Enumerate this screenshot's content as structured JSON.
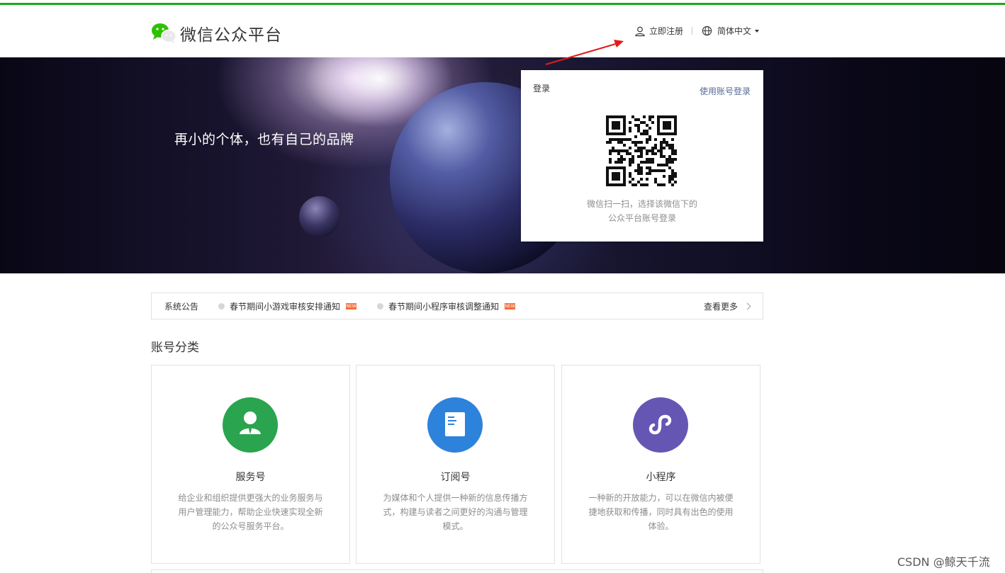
{
  "header": {
    "logo_text": "微信公众平台",
    "register_label": "立即注册",
    "language_label": "简体中文",
    "register_icon": "user-icon",
    "language_icon": "globe-icon"
  },
  "banner": {
    "slogan": "再小的个体，也有自己的品牌"
  },
  "login": {
    "title": "登录",
    "switch_label": "使用账号登录",
    "tip_line1": "微信扫一扫，选择该微信下的",
    "tip_line2": "公众平台账号登录"
  },
  "notice": {
    "label": "系统公告",
    "items": [
      {
        "text": "春节期间小游戏审核安排通知",
        "badge": "NEW"
      },
      {
        "text": "春节期间小程序审核调整通知",
        "badge": "NEW"
      }
    ],
    "more_label": "查看更多"
  },
  "section": {
    "title": "账号分类"
  },
  "accounts": [
    {
      "name": "服务号",
      "desc": "给企业和组织提供更强大的业务服务与用户管理能力，帮助企业快速实现全新的公众号服务平台。",
      "color": "#2aa44e",
      "icon": "service-person-icon"
    },
    {
      "name": "订阅号",
      "desc": "为媒体和个人提供一种新的信息传播方式，构建与读者之间更好的沟通与管理模式。",
      "color": "#2d82dc",
      "icon": "document-icon"
    },
    {
      "name": "小程序",
      "desc": "一种新的开放能力，可以在微信内被便捷地获取和传播，同时具有出色的使用体验。",
      "color": "#6656b4",
      "icon": "mini-program-icon"
    }
  ],
  "watermark": "CSDN @鲸天千流",
  "colors": {
    "brand_green": "#1aad19",
    "link_blue": "#576b95",
    "annotation_red": "#e31b1b"
  }
}
